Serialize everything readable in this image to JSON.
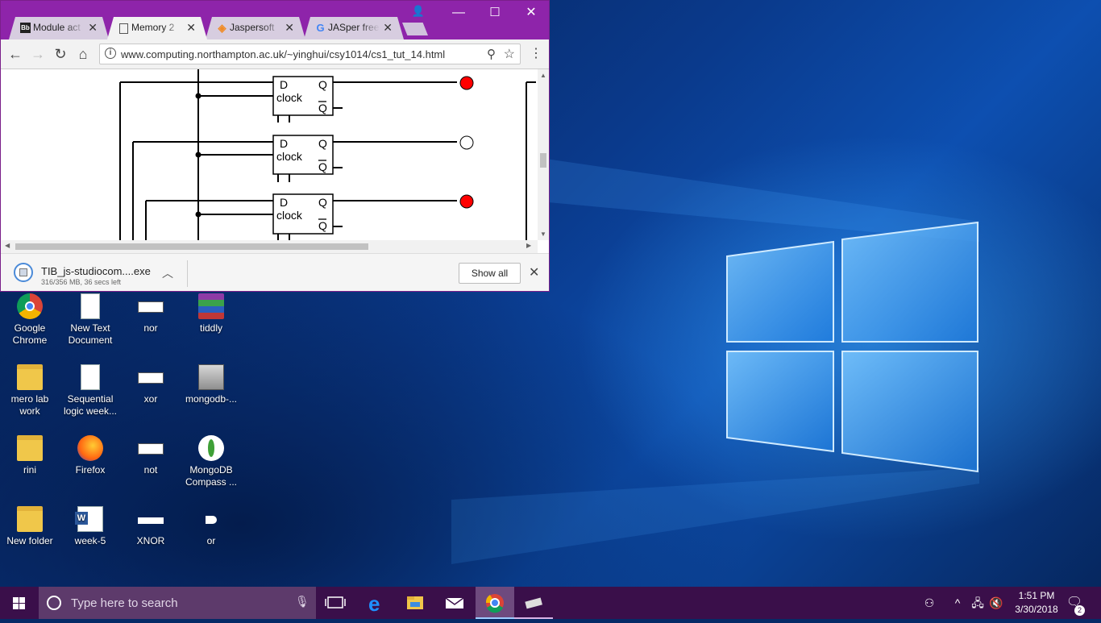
{
  "browser": {
    "tabs": [
      {
        "label": "Module act",
        "favicon": "Bb",
        "active": false
      },
      {
        "label": "Memory 2",
        "favicon": "page-icon",
        "active": true
      },
      {
        "label": "Jaspersoft",
        "favicon": "jaspersoft-icon",
        "active": false
      },
      {
        "label": "JASper free",
        "favicon": "G",
        "active": false
      }
    ],
    "url": "www.computing.northampton.ac.uk/~yinghui/csy1014/cs1_tut_14.html",
    "diagram": {
      "rows": [
        {
          "d_label": "D",
          "clock_label": "clock",
          "q_label": "Q",
          "qbar_label": "Q",
          "output_on": true
        },
        {
          "d_label": "D",
          "clock_label": "clock",
          "q_label": "Q",
          "qbar_label": "Q",
          "output_on": false
        },
        {
          "d_label": "D",
          "clock_label": "clock",
          "q_label": "Q",
          "qbar_label": "Q",
          "output_on": true
        }
      ],
      "on_color": "#ff0000",
      "off_color": "#ffffff"
    },
    "download": {
      "filename": "TIB_js-studiocom....exe",
      "status": "316/356 MB, 36 secs left",
      "progress": 0.888,
      "show_all_label": "Show all"
    }
  },
  "desktop": {
    "icons": [
      {
        "label": "Google Chrome",
        "icon": "chrome-icon"
      },
      {
        "label": "New Text Document",
        "icon": "text-document-icon"
      },
      {
        "label": "nor",
        "icon": "logic-gate-icon"
      },
      {
        "label": "tiddly",
        "icon": "winrar-archive-icon"
      },
      {
        "label": "mero lab work",
        "icon": "folder-icon"
      },
      {
        "label": "Sequential logic week...",
        "icon": "document-icon"
      },
      {
        "label": "xor",
        "icon": "logic-gate-icon"
      },
      {
        "label": "mongodb-...",
        "icon": "installer-icon"
      },
      {
        "label": "rini",
        "icon": "folder-icon"
      },
      {
        "label": "Firefox",
        "icon": "firefox-icon"
      },
      {
        "label": "not",
        "icon": "logic-gate-icon"
      },
      {
        "label": "MongoDB Compass ...",
        "icon": "mongodb-compass-icon"
      },
      {
        "label": "New folder",
        "icon": "folder-icon"
      },
      {
        "label": "week-5",
        "icon": "word-document-icon"
      },
      {
        "label": "XNOR",
        "icon": "logic-gate-icon"
      },
      {
        "label": "or",
        "icon": "logic-gate-icon"
      }
    ]
  },
  "taskbar": {
    "search_placeholder": "Type here to search",
    "time": "1:51 PM",
    "date": "3/30/2018",
    "notification_count": "2",
    "accent": "#3a0f4a"
  }
}
